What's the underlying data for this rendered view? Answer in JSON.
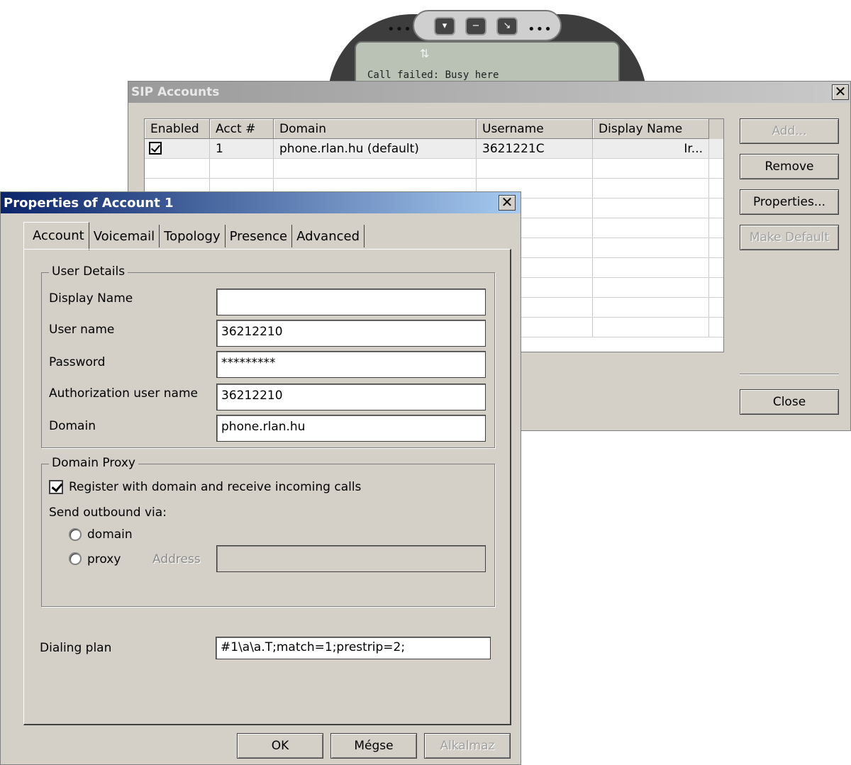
{
  "phone": {
    "status_text": "Call failed: Busy here",
    "dots_left": "•••",
    "dots_right": "•••",
    "btn1": "▾",
    "btn2": "−",
    "btn3": "↘",
    "antenna": "⇅"
  },
  "sip_window": {
    "title": "SIP Accounts",
    "close_glyph": "✕",
    "columns": [
      "Enabled",
      "Acct #",
      "Domain",
      "Username",
      "Display Name"
    ],
    "row1": {
      "acct": "1",
      "domain": "phone.rlan.hu (default)",
      "username": "3621221C",
      "display_name": "Ir..."
    },
    "buttons": {
      "add": "Add...",
      "remove": "Remove",
      "properties": "Properties...",
      "make_default": "Make Default",
      "close": "Close"
    }
  },
  "props_window": {
    "title": "Properties of Account 1",
    "close_glyph": "✕",
    "tabs": [
      "Account",
      "Voicemail",
      "Topology",
      "Presence",
      "Advanced"
    ],
    "user_details": {
      "group_title": "User Details",
      "display_name_label": "Display Name",
      "display_name_value": "",
      "user_name_label": "User name",
      "user_name_value": "36212210",
      "password_label": "Password",
      "password_value": "*********",
      "auth_user_label": "Authorization user name",
      "auth_user_value": "36212210",
      "domain_label": "Domain",
      "domain_value": "phone.rlan.hu"
    },
    "domain_proxy": {
      "group_title": "Domain Proxy",
      "register_label": "Register with domain and receive incoming calls",
      "send_outbound_label": "Send outbound via:",
      "domain_radio_label": "domain",
      "proxy_radio_label": "proxy",
      "address_label": "Address",
      "address_value": ""
    },
    "dialing_plan_label": "Dialing plan",
    "dialing_plan_value": "#1\\a\\a.T;match=1;prestrip=2;",
    "buttons": {
      "ok": "OK",
      "cancel": "Mégse",
      "apply": "Alkalmaz"
    }
  }
}
